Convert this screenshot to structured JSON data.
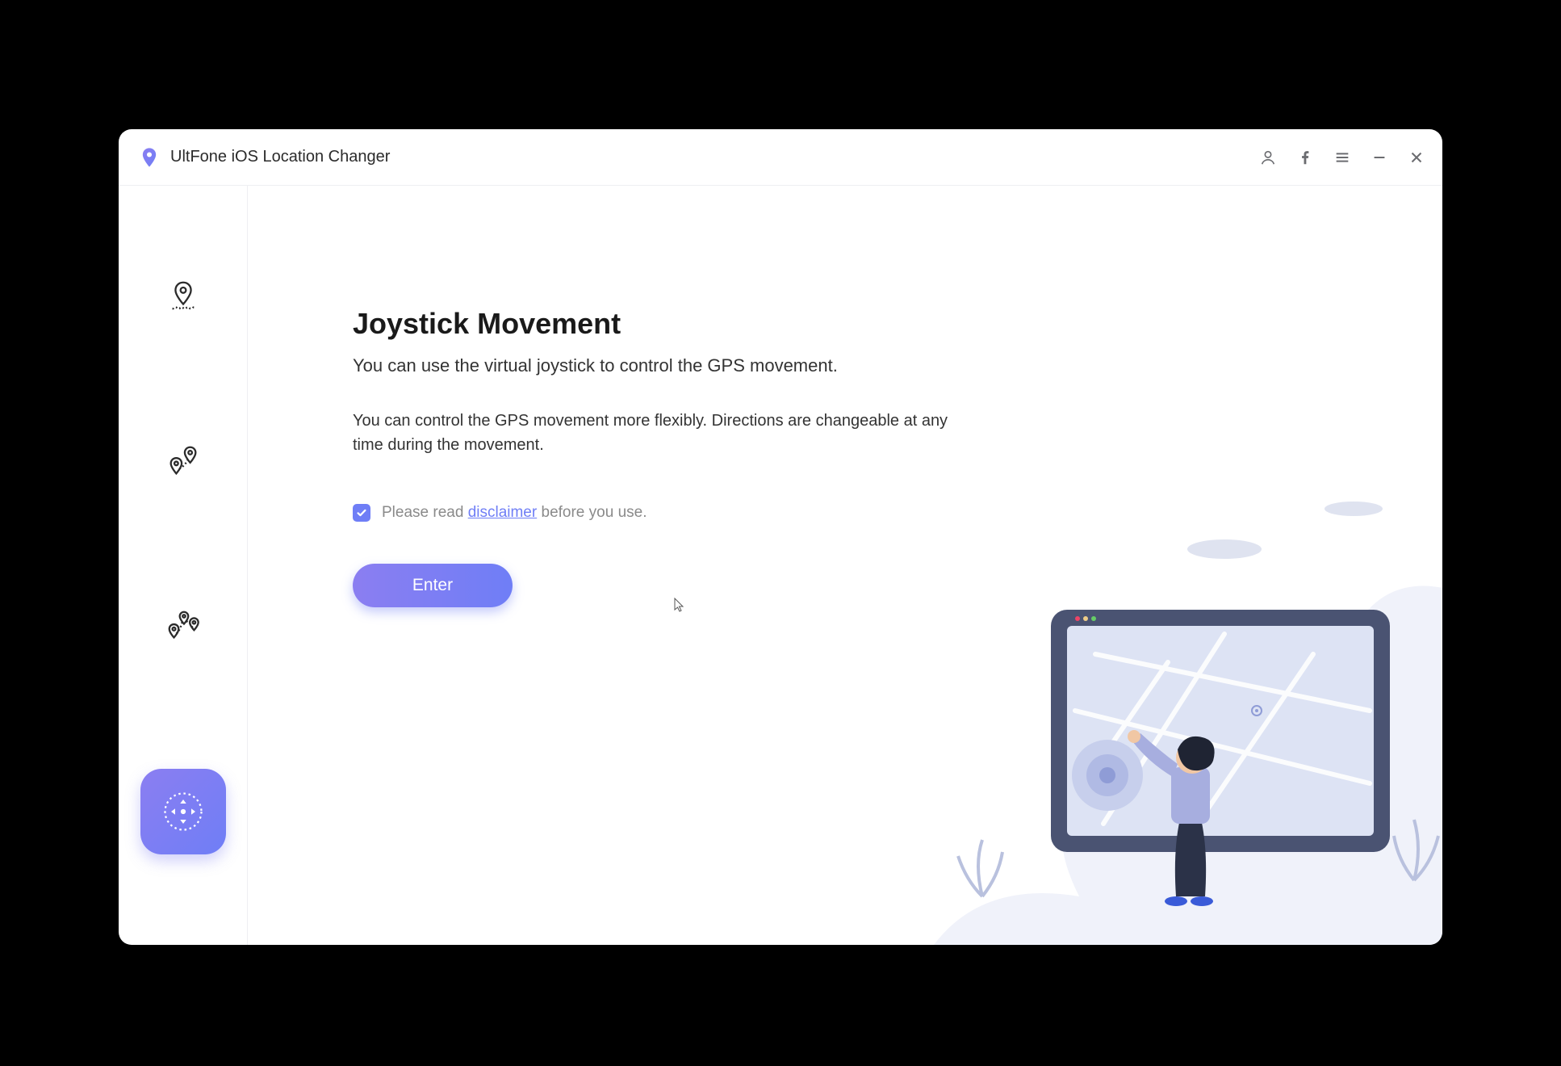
{
  "app": {
    "title": "UltFone iOS Location Changer"
  },
  "sidebar": {
    "items": [
      {
        "name": "change-location",
        "active": false
      },
      {
        "name": "single-spot",
        "active": false
      },
      {
        "name": "multi-spot",
        "active": false
      },
      {
        "name": "joystick",
        "active": true
      }
    ]
  },
  "main": {
    "heading": "Joystick Movement",
    "subhead": "You can use the virtual joystick to control the GPS movement.",
    "desc": "You can control the GPS movement more flexibly. Directions are changeable at any time during the movement.",
    "disclaimer_prefix": "Please read ",
    "disclaimer_link": "disclaimer",
    "disclaimer_suffix": " before you use.",
    "disclaimer_checked": true,
    "enter_label": "Enter"
  },
  "colors": {
    "accent_start": "#8b7ef1",
    "accent_end": "#6f7ef6",
    "text_muted": "#8a8a8a"
  }
}
